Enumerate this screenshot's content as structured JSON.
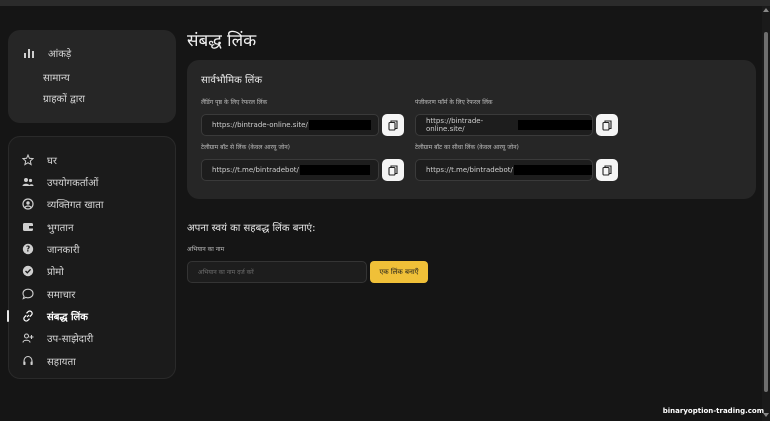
{
  "sidebar": {
    "stats": {
      "title": "आंकड़े",
      "items": [
        "सामान्य",
        "ग्राहकों द्वारा"
      ]
    },
    "nav": [
      {
        "label": "घर",
        "icon": "star-icon"
      },
      {
        "label": "उपयोगकर्ताओं",
        "icon": "users-icon"
      },
      {
        "label": "व्यक्तिगत खाता",
        "icon": "user-circle-icon"
      },
      {
        "label": "भुगतान",
        "icon": "wallet-icon"
      },
      {
        "label": "जानकारी",
        "icon": "help-icon"
      },
      {
        "label": "प्रोमो",
        "icon": "check-badge-icon"
      },
      {
        "label": "समाचार",
        "icon": "chat-icon"
      },
      {
        "label": "संबद्ध लिंक",
        "icon": "link-icon",
        "active": true
      },
      {
        "label": "उप-साझेदारी",
        "icon": "user-plus-icon"
      },
      {
        "label": "सहायता",
        "icon": "headset-icon"
      }
    ]
  },
  "page": {
    "title": "संबद्ध लिंक"
  },
  "universal": {
    "title": "सार्वभौमिक लिंक",
    "links": [
      {
        "label": "लैंडिंग पृष्ठ के लिए रेफरल लिंक",
        "url": "https://bintrade-online.site/"
      },
      {
        "label": "पंजीकरण फॉर्म के लिए रेफरल लिंक",
        "url": "https://bintrade-online.site/"
      },
      {
        "label": "टेलीग्राम बॉट से लिंक (केवल आरयू जोन)",
        "url": "https://t.me/bintradebot/"
      },
      {
        "label": "टेलीग्राम बॉट का सीधा लिंक (केवल आरयू जोन)",
        "url": "https://t.me/bintradebot/"
      }
    ]
  },
  "create": {
    "title": "अपना स्वयं का सहबद्ध लिंक बनाएं:",
    "name_label": "अभियान का नाम",
    "name_placeholder": "अभियान का नाम दर्ज करें",
    "button": "एक लिंक बनाएँ"
  },
  "watermark": "binaryoption-trading.com"
}
